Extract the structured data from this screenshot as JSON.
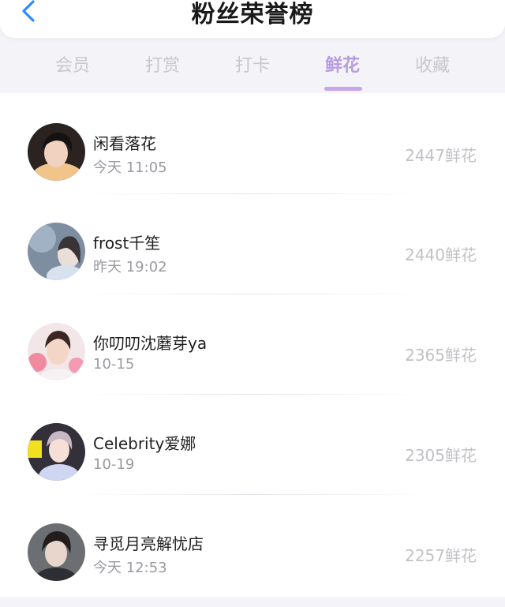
{
  "header": {
    "title": "粉丝荣誉榜"
  },
  "tabs": [
    {
      "label": "会员"
    },
    {
      "label": "打赏"
    },
    {
      "label": "打卡"
    },
    {
      "label": "鲜花"
    },
    {
      "label": "收藏"
    }
  ],
  "active_tab": "鲜花",
  "rows": [
    {
      "name": "闲看落花",
      "time": "今天 11:05",
      "amount": "2447鲜花"
    },
    {
      "name": "frost千笙",
      "time": "昨天 19:02",
      "amount": "2440鲜花"
    },
    {
      "name": "你叨叨沈蘑芽ya",
      "time": "10-15",
      "amount": "2365鲜花"
    },
    {
      "name": "Celebrity爱娜",
      "time": "10-19",
      "amount": "2305鲜花"
    },
    {
      "name": "寻觅月亮解忧店",
      "time": "今天 12:53",
      "amount": "2257鲜花"
    }
  ],
  "colors": {
    "accent": "#b79be0",
    "underline": "#c7a6ea",
    "back_icon": "#2a8cff"
  },
  "icons": {
    "back": "chevron-left-icon"
  }
}
